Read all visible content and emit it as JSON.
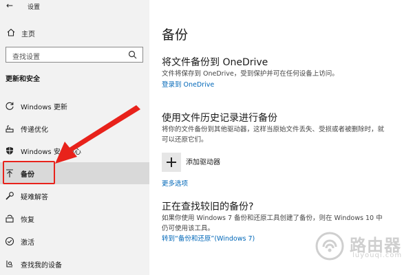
{
  "window": {
    "title": "设置"
  },
  "sidebar": {
    "home_label": "主页",
    "search_placeholder": "查找设置",
    "section_title": "更新和安全",
    "items": [
      {
        "label": "Windows 更新",
        "icon": "refresh-icon"
      },
      {
        "label": "传递优化",
        "icon": "delivery-optimization-icon"
      },
      {
        "label": "Windows 安全中心",
        "icon": "shield-icon"
      },
      {
        "label": "备份",
        "icon": "backup-arrow-icon",
        "selected": true
      },
      {
        "label": "疑难解答",
        "icon": "wrench-icon"
      },
      {
        "label": "恢复",
        "icon": "recovery-icon"
      },
      {
        "label": "激活",
        "icon": "check-circle-icon"
      },
      {
        "label": "查找我的设备",
        "icon": "find-device-icon"
      }
    ]
  },
  "main": {
    "title": "备份",
    "onedrive": {
      "heading": "将文件备份到 OneDrive",
      "desc": "文件将保存到 OneDrive，受到保护并可在任何设备上访问。",
      "link": "登录到 OneDrive"
    },
    "file_history": {
      "heading": "使用文件历史记录进行备份",
      "desc": "将你的文件备份到其他驱动器，这样当原始文件丢失、受损或者被删除时，就可以还原它们。",
      "add_drive_label": "添加驱动器",
      "more_options": "更多选项"
    },
    "older_backup": {
      "heading": "正在查找较旧的备份?",
      "desc": "如果你使用 Windows 7 备份和还原工具创建了备份，则在 Windows 10 中仍可使用该工具。",
      "link": "转到“备份和还原”(Windows 7)"
    }
  },
  "colors": {
    "accent": "#0067b8",
    "highlight": "#e8221b",
    "sidebar_bg": "#f2f2f2",
    "selected_bg": "#d9d9d9"
  },
  "watermark": {
    "text": "路由器",
    "sub": "luyouqi.com"
  }
}
